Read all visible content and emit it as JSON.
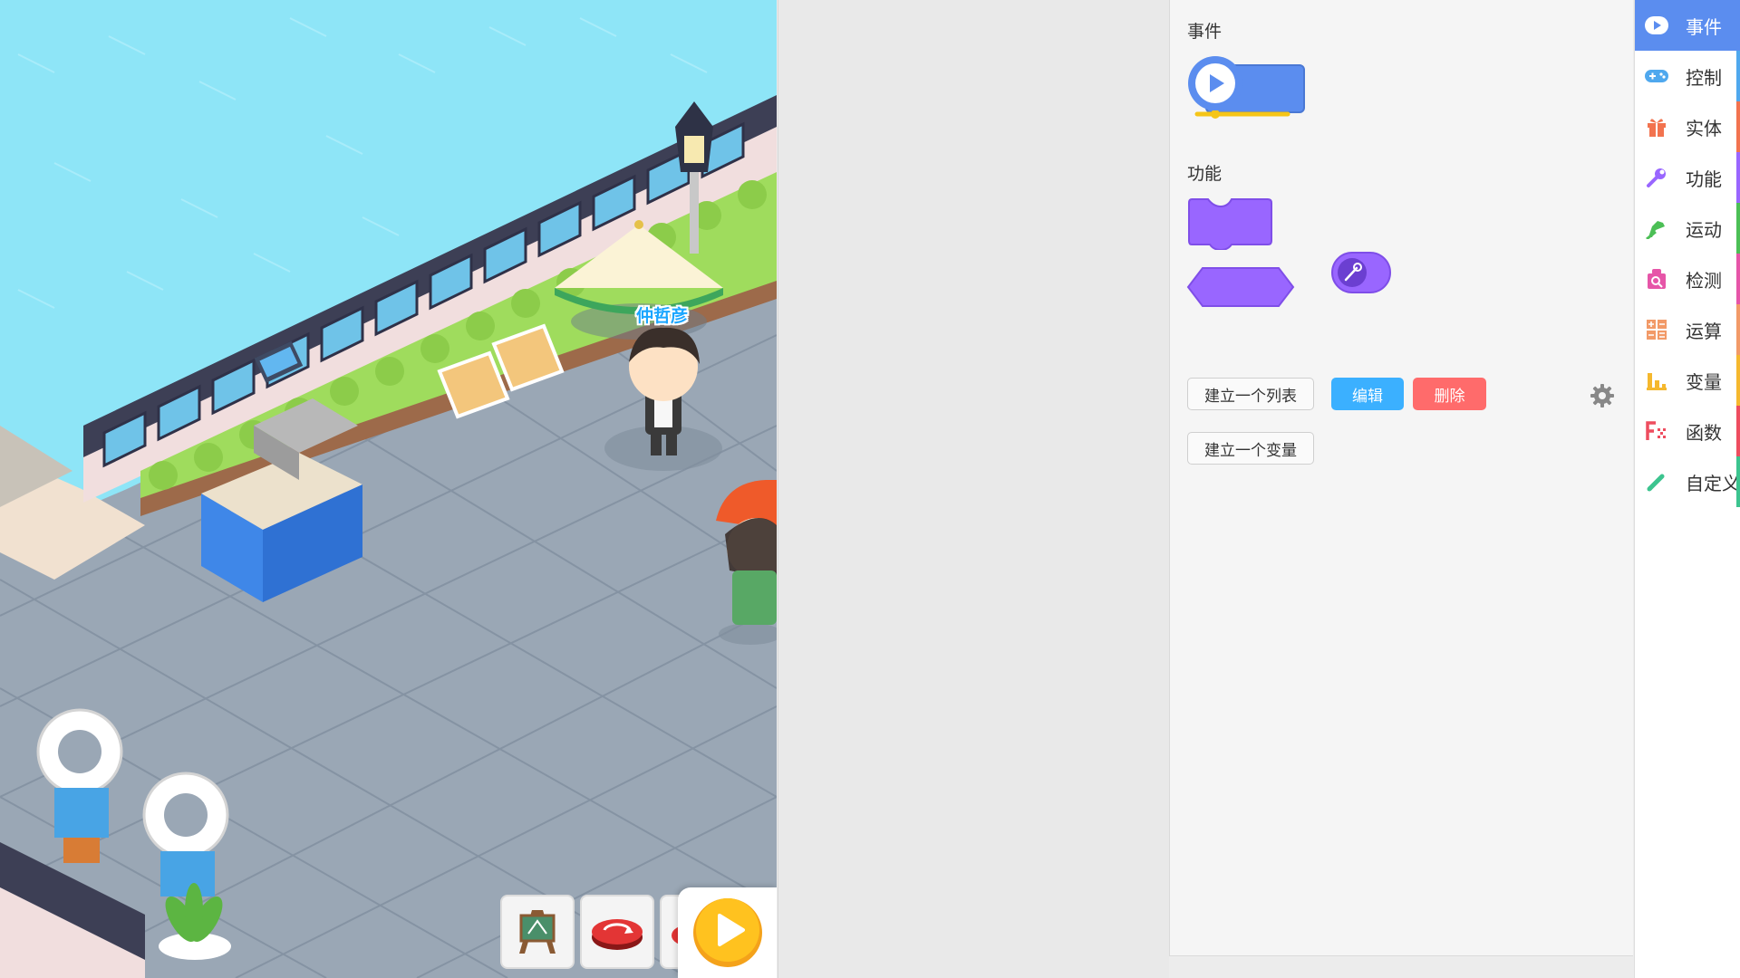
{
  "stage": {
    "player_name": "仲哲彦"
  },
  "palette": {
    "events_title": "事件",
    "function_title": "功能",
    "buttons": {
      "create_list": "建立一个列表",
      "edit": "编辑",
      "delete": "删除",
      "create_variable": "建立一个变量"
    }
  },
  "categories": [
    {
      "label": "事件",
      "icon": "play-icon",
      "color": "#5b8def",
      "active": true
    },
    {
      "label": "控制",
      "icon": "gamepad-icon",
      "color": "#4fa8ee",
      "active": false
    },
    {
      "label": "实体",
      "icon": "gift-icon",
      "color": "#f2734f",
      "active": false
    },
    {
      "label": "功能",
      "icon": "wrench-icon",
      "color": "#9966ff",
      "active": false
    },
    {
      "label": "运动",
      "icon": "shoe-icon",
      "color": "#4cbf56",
      "active": false
    },
    {
      "label": "检测",
      "icon": "detect-icon",
      "color": "#e655a8",
      "active": false
    },
    {
      "label": "运算",
      "icon": "calculator-icon",
      "color": "#f29a68",
      "active": false
    },
    {
      "label": "变量",
      "icon": "bar-chart-icon",
      "color": "#f5b82e",
      "active": false
    },
    {
      "label": "函数",
      "icon": "function-icon",
      "color": "#ee4d5f",
      "active": false
    },
    {
      "label": "自定义",
      "icon": "pen-icon",
      "color": "#3cc48f",
      "active": false
    }
  ],
  "colors": {
    "event_block": "#5b8def",
    "function_block": "#9966ff",
    "edit_button": "#3bb0ff",
    "delete_button": "#ff6b6b"
  }
}
